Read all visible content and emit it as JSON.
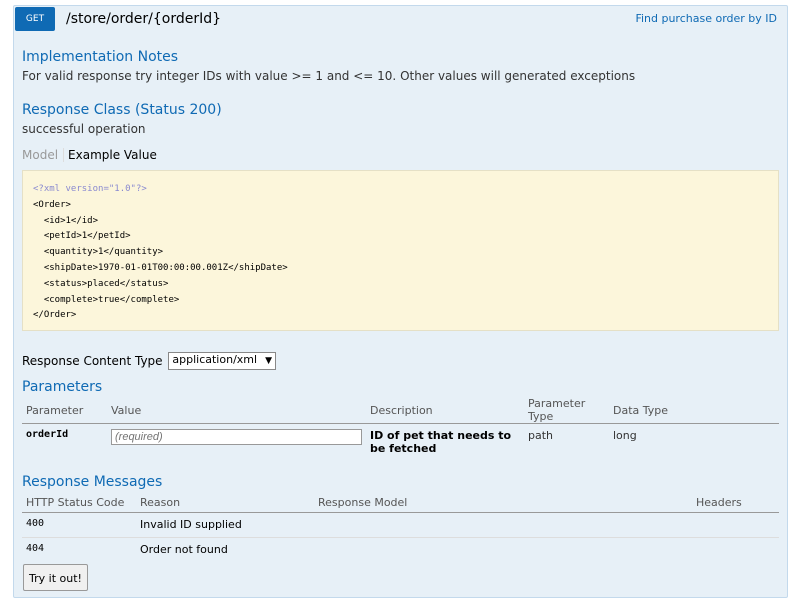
{
  "operation": {
    "method": "GET",
    "path": "/store/order/{orderId}",
    "summary": "Find purchase order by ID",
    "colors": {
      "method_bg": "#0f6ab4",
      "panel_bg": "#e7f0f7",
      "code_bg": "#fcf6db"
    }
  },
  "implementation_notes": {
    "title": "Implementation Notes",
    "text": "For valid response try integer IDs with value >= 1 and <= 10. Other values will generated exceptions"
  },
  "response_class": {
    "title": "Response Class (Status 200)",
    "description": "successful operation",
    "tabs": [
      "Model",
      "Example Value"
    ],
    "active_tab": "Example Value",
    "example_lines": [
      "<?xml version=\"1.0\"?>",
      "<Order>",
      "  <id>1</id>",
      "  <petId>1</petId>",
      "  <quantity>1</quantity>",
      "  <shipDate>1970-01-01T00:00:00.001Z</shipDate>",
      "  <status>placed</status>",
      "  <complete>true</complete>",
      "</Order>"
    ]
  },
  "content_type": {
    "label": "Response Content Type",
    "selected": "application/xml"
  },
  "parameters": {
    "title": "Parameters",
    "headers": [
      "Parameter",
      "Value",
      "Description",
      "Parameter Type",
      "Data Type"
    ],
    "rows": [
      {
        "name": "orderId",
        "placeholder": "(required)",
        "description": "ID of pet that needs to be fetched",
        "param_type": "path",
        "data_type": "long"
      }
    ]
  },
  "response_messages": {
    "title": "Response Messages",
    "headers": [
      "HTTP Status Code",
      "Reason",
      "Response Model",
      "Headers"
    ],
    "rows": [
      {
        "code": "400",
        "reason": "Invalid ID supplied",
        "model": "",
        "headers": ""
      },
      {
        "code": "404",
        "reason": "Order not found",
        "model": "",
        "headers": ""
      }
    ]
  },
  "try_button": {
    "label": "Try it out!"
  }
}
